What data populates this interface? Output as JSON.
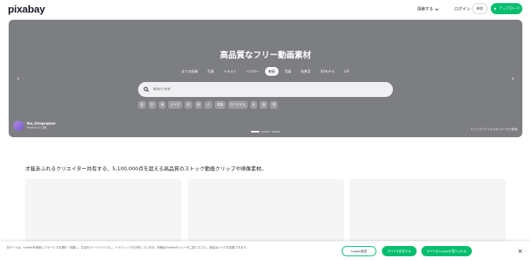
{
  "header": {
    "logo": "pixabay",
    "explore_label": "探索する",
    "login_label": "ログイン",
    "join_label": "参加",
    "upload_label": "アップロード"
  },
  "hero": {
    "title": "高品質なフリー動画素材",
    "categories": [
      {
        "label": "全ての画像",
        "active": false
      },
      {
        "label": "写真",
        "active": false
      },
      {
        "label": "イラスト",
        "active": false
      },
      {
        "label": "ベクター",
        "active": false
      },
      {
        "label": "動画",
        "active": true
      },
      {
        "label": "音楽",
        "active": false
      },
      {
        "label": "効果音",
        "active": false
      },
      {
        "label": "3Dモデル",
        "active": false
      },
      {
        "label": "GIF",
        "active": false
      }
    ],
    "search": {
      "placeholder": "動画を検索"
    },
    "tags": [
      "夏",
      "空",
      "海",
      "ビデオ",
      "花",
      "雨",
      "人",
      "背景",
      "クリスマス",
      "木",
      "旅",
      "雪"
    ],
    "author": {
      "name": "tha_fotographer",
      "subtitle": "Pixabayで公開"
    },
    "credit": "ピックスアベイのスポンサー付き動画"
  },
  "main": {
    "heading": "才能あふれるクリエイター共有する、5,100,000点を超える高品質のストック動画クリップや映像素材。"
  },
  "cookie": {
    "text": "当サイトは、Cookieを使用してサービスを提供・改善し、広告をパーソナライズし、トラフィックを分析しています。詳細はCookieポリシーをご覧ください。設定はいつでも変更できます。",
    "settings_label": "Cookie設定",
    "reject_label": "すべてを拒否する",
    "accept_label": "すべてのCookieを受け入れる",
    "close_label": "×"
  },
  "colors": {
    "accent": "#02be6e",
    "hero_bg": "#7d7e82",
    "text": "#191b26"
  }
}
